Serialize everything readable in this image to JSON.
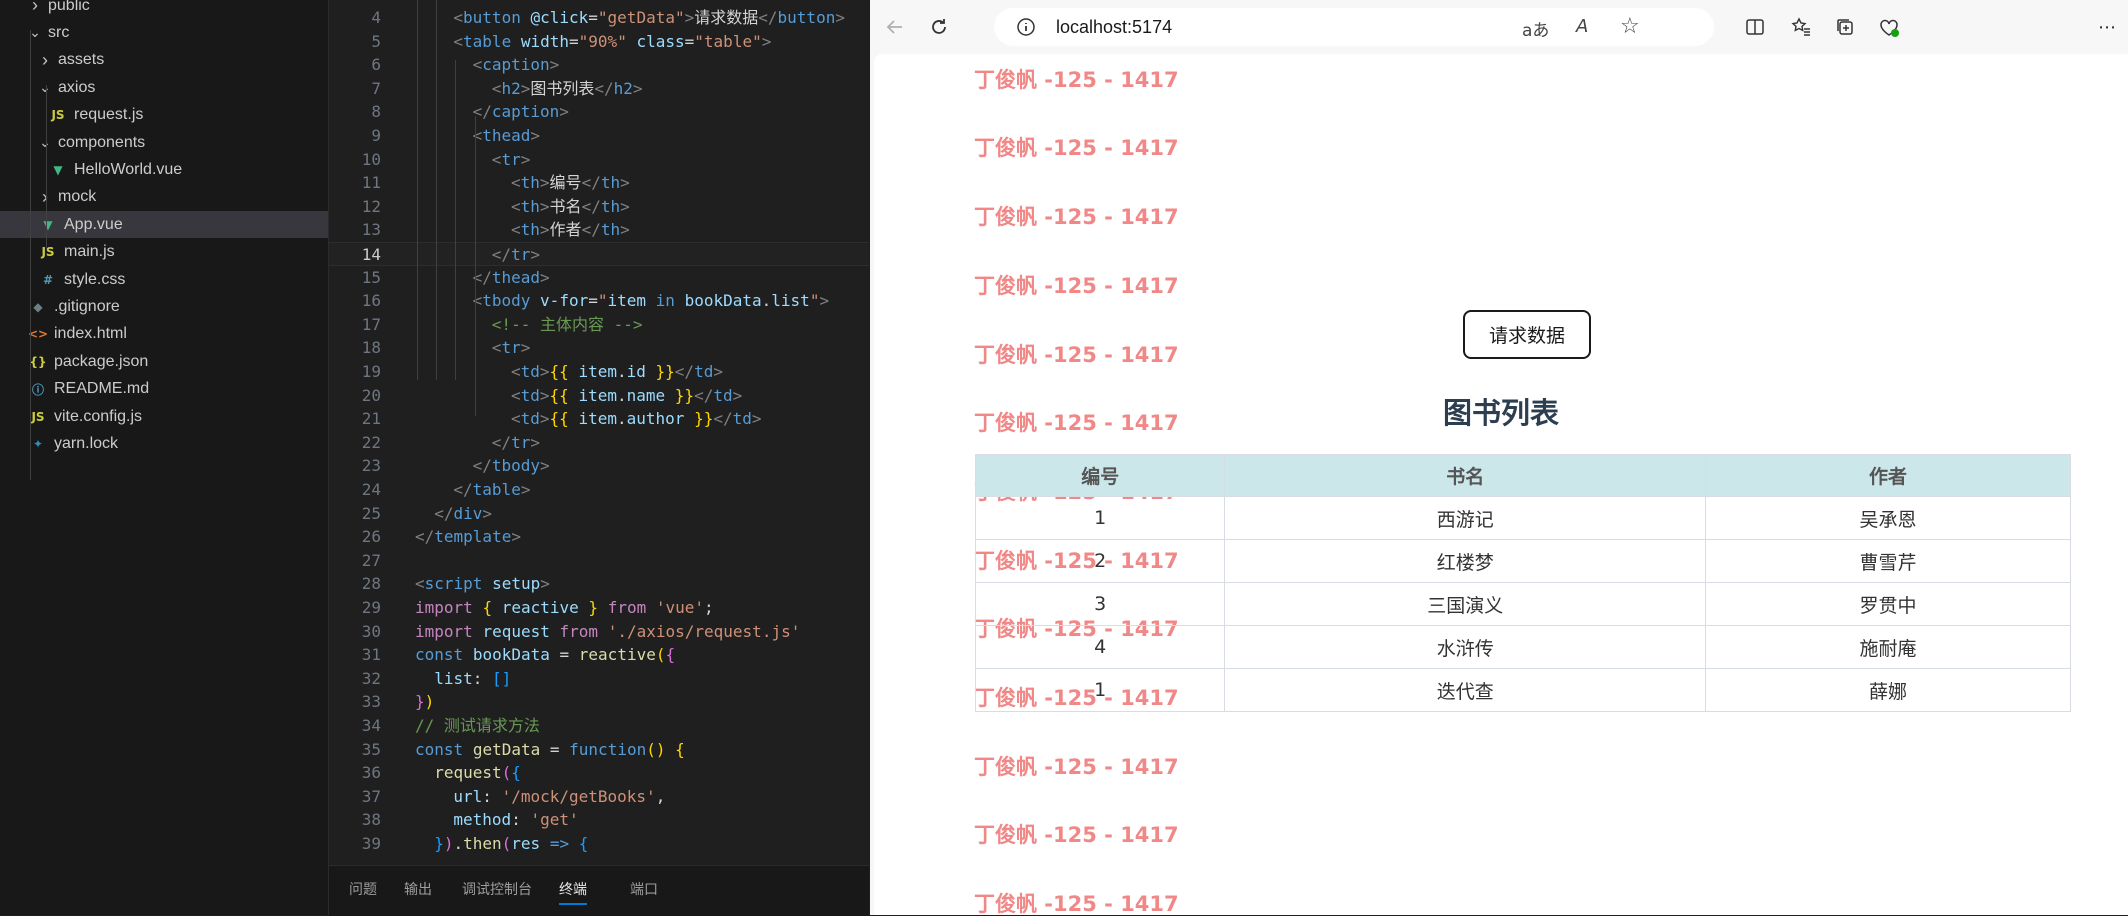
{
  "explorer": {
    "items": [
      {
        "label": "public",
        "kind": "folder",
        "open": false,
        "depth": 0
      },
      {
        "label": "src",
        "kind": "folder",
        "open": true,
        "depth": 0
      },
      {
        "label": "assets",
        "kind": "folder",
        "open": false,
        "depth": 1
      },
      {
        "label": "axios",
        "kind": "folder",
        "open": true,
        "depth": 1
      },
      {
        "label": "request.js",
        "kind": "js",
        "depth": 2
      },
      {
        "label": "components",
        "kind": "folder",
        "open": true,
        "depth": 1
      },
      {
        "label": "HelloWorld.vue",
        "kind": "vue",
        "depth": 2
      },
      {
        "label": "mock",
        "kind": "folder",
        "open": false,
        "depth": 1
      },
      {
        "label": "App.vue",
        "kind": "vue",
        "depth": 1,
        "selected": true
      },
      {
        "label": "main.js",
        "kind": "js",
        "depth": 1
      },
      {
        "label": "style.css",
        "kind": "css",
        "depth": 1
      },
      {
        "label": ".gitignore",
        "kind": "git",
        "depth": 0
      },
      {
        "label": "index.html",
        "kind": "html",
        "depth": 0
      },
      {
        "label": "package.json",
        "kind": "json",
        "depth": 0
      },
      {
        "label": "README.md",
        "kind": "info",
        "depth": 0
      },
      {
        "label": "vite.config.js",
        "kind": "js",
        "depth": 0
      },
      {
        "label": "yarn.lock",
        "kind": "yarn",
        "depth": 0
      }
    ],
    "icon_colors": {
      "js": "#cbcb41",
      "vue": "#41b883",
      "css": "#519aba",
      "git": "#6d8086",
      "html": "#e37933",
      "json": "#cbcb41",
      "info": "#519aba",
      "yarn": "#2c8ebb"
    }
  },
  "editor": {
    "active_line": 14,
    "lines": [
      {
        "n": 4,
        "tokens": [
          [
            "t-punct",
            "<"
          ],
          [
            "t-tag",
            "button"
          ],
          [
            "t-text",
            " "
          ],
          [
            "t-attr",
            "@click"
          ],
          [
            "t-text",
            "="
          ],
          [
            "t-str",
            "\"getData\""
          ],
          [
            "t-punct",
            ">"
          ],
          [
            "t-text",
            "请求数据"
          ],
          [
            "t-punct",
            "</"
          ],
          [
            "t-tag",
            "button"
          ],
          [
            "t-punct",
            ">"
          ]
        ],
        "indent": 2
      },
      {
        "n": 5,
        "tokens": [
          [
            "t-punct",
            "<"
          ],
          [
            "t-tag",
            "table"
          ],
          [
            "t-text",
            " "
          ],
          [
            "t-attr",
            "width"
          ],
          [
            "t-text",
            "="
          ],
          [
            "t-str",
            "\"90%\""
          ],
          [
            "t-text",
            " "
          ],
          [
            "t-attr",
            "class"
          ],
          [
            "t-text",
            "="
          ],
          [
            "t-str",
            "\"table\""
          ],
          [
            "t-punct",
            ">"
          ]
        ],
        "indent": 2
      },
      {
        "n": 6,
        "tokens": [
          [
            "t-punct",
            "<"
          ],
          [
            "t-tag",
            "caption"
          ],
          [
            "t-punct",
            ">"
          ]
        ],
        "indent": 3
      },
      {
        "n": 7,
        "tokens": [
          [
            "t-punct",
            "<"
          ],
          [
            "t-tag",
            "h2"
          ],
          [
            "t-punct",
            ">"
          ],
          [
            "t-text",
            "图书列表"
          ],
          [
            "t-punct",
            "</"
          ],
          [
            "t-tag",
            "h2"
          ],
          [
            "t-punct",
            ">"
          ]
        ],
        "indent": 4
      },
      {
        "n": 8,
        "tokens": [
          [
            "t-punct",
            "</"
          ],
          [
            "t-tag",
            "caption"
          ],
          [
            "t-punct",
            ">"
          ]
        ],
        "indent": 3
      },
      {
        "n": 9,
        "tokens": [
          [
            "t-punct",
            "<"
          ],
          [
            "t-tag",
            "thead"
          ],
          [
            "t-punct",
            ">"
          ]
        ],
        "indent": 3
      },
      {
        "n": 10,
        "tokens": [
          [
            "t-punct",
            "<"
          ],
          [
            "t-tag",
            "tr"
          ],
          [
            "t-punct",
            ">"
          ]
        ],
        "indent": 4
      },
      {
        "n": 11,
        "tokens": [
          [
            "t-punct",
            "<"
          ],
          [
            "t-tag",
            "th"
          ],
          [
            "t-punct",
            ">"
          ],
          [
            "t-text",
            "编号"
          ],
          [
            "t-punct",
            "</"
          ],
          [
            "t-tag",
            "th"
          ],
          [
            "t-punct",
            ">"
          ]
        ],
        "indent": 5
      },
      {
        "n": 12,
        "tokens": [
          [
            "t-punct",
            "<"
          ],
          [
            "t-tag",
            "th"
          ],
          [
            "t-punct",
            ">"
          ],
          [
            "t-text",
            "书名"
          ],
          [
            "t-punct",
            "</"
          ],
          [
            "t-tag",
            "th"
          ],
          [
            "t-punct",
            ">"
          ]
        ],
        "indent": 5
      },
      {
        "n": 13,
        "tokens": [
          [
            "t-punct",
            "<"
          ],
          [
            "t-tag",
            "th"
          ],
          [
            "t-punct",
            ">"
          ],
          [
            "t-text",
            "作者"
          ],
          [
            "t-punct",
            "</"
          ],
          [
            "t-tag",
            "th"
          ],
          [
            "t-punct",
            ">"
          ]
        ],
        "indent": 5
      },
      {
        "n": 14,
        "tokens": [
          [
            "t-punct",
            "</"
          ],
          [
            "t-tag",
            "tr"
          ],
          [
            "t-punct",
            ">"
          ]
        ],
        "indent": 4
      },
      {
        "n": 15,
        "tokens": [
          [
            "t-punct",
            "</"
          ],
          [
            "t-tag",
            "thead"
          ],
          [
            "t-punct",
            ">"
          ]
        ],
        "indent": 3
      },
      {
        "n": 16,
        "tokens": [
          [
            "t-punct",
            "<"
          ],
          [
            "t-tag",
            "tbody"
          ],
          [
            "t-text",
            " "
          ],
          [
            "t-attr",
            "v-for"
          ],
          [
            "t-text",
            "="
          ],
          [
            "t-str",
            "\""
          ],
          [
            "t-var",
            "item"
          ],
          [
            "t-text",
            " "
          ],
          [
            "t-kw2",
            "in"
          ],
          [
            "t-text",
            " "
          ],
          [
            "t-var",
            "bookData"
          ],
          [
            "t-text",
            "."
          ],
          [
            "t-var",
            "list"
          ],
          [
            "t-str",
            "\""
          ],
          [
            "t-punct",
            ">"
          ]
        ],
        "indent": 3
      },
      {
        "n": 17,
        "tokens": [
          [
            "t-com",
            "<!-- 主体内容 -->"
          ]
        ],
        "indent": 4
      },
      {
        "n": 18,
        "tokens": [
          [
            "t-punct",
            "<"
          ],
          [
            "t-tag",
            "tr"
          ],
          [
            "t-punct",
            ">"
          ]
        ],
        "indent": 4
      },
      {
        "n": 19,
        "tokens": [
          [
            "t-punct",
            "<"
          ],
          [
            "t-tag",
            "td"
          ],
          [
            "t-punct",
            ">"
          ],
          [
            "t-brace",
            "{{"
          ],
          [
            "t-text",
            " "
          ],
          [
            "t-var",
            "item"
          ],
          [
            "t-text",
            "."
          ],
          [
            "t-var",
            "id"
          ],
          [
            "t-text",
            " "
          ],
          [
            "t-brace",
            "}}"
          ],
          [
            "t-punct",
            "</"
          ],
          [
            "t-tag",
            "td"
          ],
          [
            "t-punct",
            ">"
          ]
        ],
        "indent": 5
      },
      {
        "n": 20,
        "tokens": [
          [
            "t-punct",
            "<"
          ],
          [
            "t-tag",
            "td"
          ],
          [
            "t-punct",
            ">"
          ],
          [
            "t-brace",
            "{{"
          ],
          [
            "t-text",
            " "
          ],
          [
            "t-var",
            "item"
          ],
          [
            "t-text",
            "."
          ],
          [
            "t-var",
            "name"
          ],
          [
            "t-text",
            " "
          ],
          [
            "t-brace",
            "}}"
          ],
          [
            "t-punct",
            "</"
          ],
          [
            "t-tag",
            "td"
          ],
          [
            "t-punct",
            ">"
          ]
        ],
        "indent": 5
      },
      {
        "n": 21,
        "tokens": [
          [
            "t-punct",
            "<"
          ],
          [
            "t-tag",
            "td"
          ],
          [
            "t-punct",
            ">"
          ],
          [
            "t-brace",
            "{{"
          ],
          [
            "t-text",
            " "
          ],
          [
            "t-var",
            "item"
          ],
          [
            "t-text",
            "."
          ],
          [
            "t-var",
            "author"
          ],
          [
            "t-text",
            " "
          ],
          [
            "t-brace",
            "}}"
          ],
          [
            "t-punct",
            "</"
          ],
          [
            "t-tag",
            "td"
          ],
          [
            "t-punct",
            ">"
          ]
        ],
        "indent": 5
      },
      {
        "n": 22,
        "tokens": [
          [
            "t-punct",
            "</"
          ],
          [
            "t-tag",
            "tr"
          ],
          [
            "t-punct",
            ">"
          ]
        ],
        "indent": 4
      },
      {
        "n": 23,
        "tokens": [
          [
            "t-punct",
            "</"
          ],
          [
            "t-tag",
            "tbody"
          ],
          [
            "t-punct",
            ">"
          ]
        ],
        "indent": 3
      },
      {
        "n": 24,
        "tokens": [
          [
            "t-punct",
            "</"
          ],
          [
            "t-tag",
            "table"
          ],
          [
            "t-punct",
            ">"
          ]
        ],
        "indent": 2
      },
      {
        "n": 25,
        "tokens": [
          [
            "t-punct",
            "</"
          ],
          [
            "t-tag",
            "div"
          ],
          [
            "t-punct",
            ">"
          ]
        ],
        "indent": 1
      },
      {
        "n": 26,
        "tokens": [
          [
            "t-punct",
            "</"
          ],
          [
            "t-tag",
            "template"
          ],
          [
            "t-punct",
            ">"
          ]
        ],
        "indent": 0
      },
      {
        "n": 27,
        "tokens": [],
        "indent": 0
      },
      {
        "n": 28,
        "tokens": [
          [
            "t-punct",
            "<"
          ],
          [
            "t-tag",
            "script"
          ],
          [
            "t-text",
            " "
          ],
          [
            "t-attr",
            "setup"
          ],
          [
            "t-punct",
            ">"
          ]
        ],
        "indent": 0
      },
      {
        "n": 29,
        "tokens": [
          [
            "t-kw",
            "import"
          ],
          [
            "t-text",
            " "
          ],
          [
            "t-brace",
            "{"
          ],
          [
            "t-text",
            " "
          ],
          [
            "t-var",
            "reactive"
          ],
          [
            "t-text",
            " "
          ],
          [
            "t-brace",
            "}"
          ],
          [
            "t-text",
            " "
          ],
          [
            "t-kw",
            "from"
          ],
          [
            "t-text",
            " "
          ],
          [
            "t-str",
            "'vue'"
          ],
          [
            "t-text",
            ";"
          ]
        ],
        "indent": 0
      },
      {
        "n": 30,
        "tokens": [
          [
            "t-kw",
            "import"
          ],
          [
            "t-text",
            " "
          ],
          [
            "t-var",
            "request"
          ],
          [
            "t-text",
            " "
          ],
          [
            "t-kw",
            "from"
          ],
          [
            "t-text",
            " "
          ],
          [
            "t-str",
            "'./axios/request.js'"
          ]
        ],
        "indent": 0
      },
      {
        "n": 31,
        "tokens": [
          [
            "t-kw2",
            "const"
          ],
          [
            "t-text",
            " "
          ],
          [
            "t-var",
            "bookData"
          ],
          [
            "t-text",
            " = "
          ],
          [
            "t-fn",
            "reactive"
          ],
          [
            "t-brace",
            "("
          ],
          [
            "t-brace2",
            "{"
          ]
        ],
        "indent": 0
      },
      {
        "n": 32,
        "tokens": [
          [
            "t-var",
            "list"
          ],
          [
            "t-text",
            ": "
          ],
          [
            "t-brace3",
            "[]"
          ]
        ],
        "indent": 1
      },
      {
        "n": 33,
        "tokens": [
          [
            "t-brace2",
            "}"
          ],
          [
            "t-brace",
            ")"
          ]
        ],
        "indent": 0
      },
      {
        "n": 34,
        "tokens": [
          [
            "t-com",
            "// 测试请求方法"
          ]
        ],
        "indent": 0
      },
      {
        "n": 35,
        "tokens": [
          [
            "t-kw2",
            "const"
          ],
          [
            "t-text",
            " "
          ],
          [
            "t-fn",
            "getData"
          ],
          [
            "t-text",
            " = "
          ],
          [
            "t-kw2",
            "function"
          ],
          [
            "t-brace",
            "()"
          ],
          [
            "t-text",
            " "
          ],
          [
            "t-brace",
            "{"
          ]
        ],
        "indent": 0
      },
      {
        "n": 36,
        "tokens": [
          [
            "t-fn",
            "request"
          ],
          [
            "t-brace2",
            "("
          ],
          [
            "t-brace3",
            "{"
          ]
        ],
        "indent": 1
      },
      {
        "n": 37,
        "tokens": [
          [
            "t-var",
            "url"
          ],
          [
            "t-text",
            ": "
          ],
          [
            "t-str",
            "'/mock/getBooks'"
          ],
          [
            "t-text",
            ","
          ]
        ],
        "indent": 2
      },
      {
        "n": 38,
        "tokens": [
          [
            "t-var",
            "method"
          ],
          [
            "t-text",
            ": "
          ],
          [
            "t-str",
            "'get'"
          ]
        ],
        "indent": 2
      },
      {
        "n": 39,
        "tokens": [
          [
            "t-brace3",
            "}"
          ],
          [
            "t-brace2",
            ")"
          ],
          [
            "t-text",
            "."
          ],
          [
            "t-fn",
            "then"
          ],
          [
            "t-brace2",
            "("
          ],
          [
            "t-var",
            "res"
          ],
          [
            "t-text",
            " "
          ],
          [
            "t-kw2",
            "=>"
          ],
          [
            "t-text",
            " "
          ],
          [
            "t-brace3",
            "{"
          ]
        ],
        "indent": 1
      }
    ]
  },
  "panel": {
    "tabs": [
      {
        "label": "问题",
        "active": false
      },
      {
        "label": "输出",
        "active": false
      },
      {
        "label": "调试控制台",
        "active": false
      },
      {
        "label": "终端",
        "active": true
      },
      {
        "label": "端口",
        "active": false
      }
    ]
  },
  "browser": {
    "url": "localhost:5174",
    "button_label": "请求数据",
    "heading": "图书列表",
    "columns": [
      "编号",
      "书名",
      "作者"
    ],
    "rows": [
      [
        "1",
        "西游记",
        "吴承恩"
      ],
      [
        "2",
        "红楼梦",
        "曹雪芹"
      ],
      [
        "3",
        "三国演义",
        "罗贯中"
      ],
      [
        "4",
        "水浒传",
        "施耐庵"
      ],
      [
        "1",
        "迭代查",
        "薛娜"
      ]
    ],
    "watermark": "丁俊帆 -125 - 1417",
    "watermark_repeat": 14
  }
}
